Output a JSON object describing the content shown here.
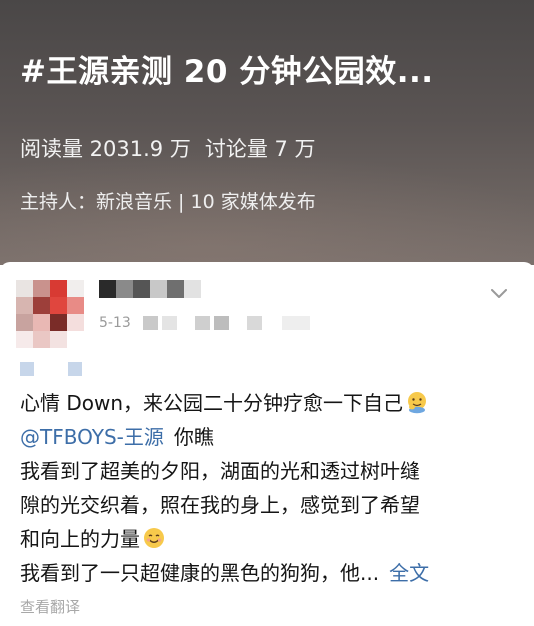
{
  "header": {
    "title": "#王源亲测 20 分钟公园效...",
    "reads": "阅读量 2031.9 万",
    "discussions": "讨论量 7 万",
    "host": "主持人：新浪音乐 | 10 家媒体发布"
  },
  "post": {
    "date": "5-13",
    "lines": [
      "心情 Down，来公园二十分钟疗愈一下自己",
      "你瞧",
      "我看到了超美的夕阳，湖面的光和透过树叶缝",
      "隙的光交织着，照在我的身上，感觉到了希望",
      "和向上的力量",
      "我看到了一只超健康的黑色的狗狗，他..."
    ],
    "mention": "@TFBOYS-王源",
    "full_text_label": "全文",
    "translate_label": "查看翻译",
    "emojis": [
      "face-with-hand-icon",
      "smiling-face-icon"
    ]
  },
  "colors": {
    "link": "#3d6ea8",
    "muted": "#9a9a9a",
    "avatar_red": "#d83a33"
  }
}
